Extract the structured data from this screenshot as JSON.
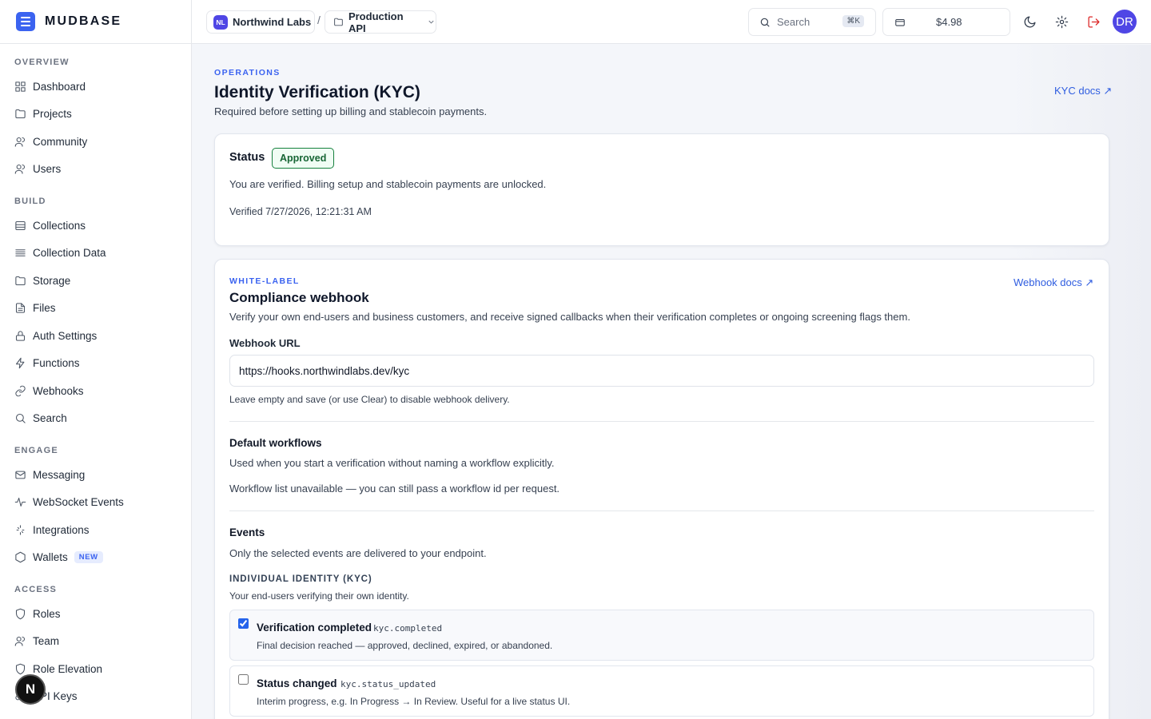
{
  "brand": {
    "name": "MUDBASE"
  },
  "sidebar": {
    "sections": [
      {
        "label": "OVERVIEW",
        "items": [
          {
            "label": "Dashboard",
            "icon": "grid-icon"
          },
          {
            "label": "Projects",
            "icon": "folder-icon"
          },
          {
            "label": "Community",
            "icon": "users-icon"
          },
          {
            "label": "Users",
            "icon": "users-icon"
          }
        ]
      },
      {
        "label": "BUILD",
        "items": [
          {
            "label": "Collections",
            "icon": "database-icon"
          },
          {
            "label": "Collection Data",
            "icon": "list-icon"
          },
          {
            "label": "Storage",
            "icon": "folder-icon"
          },
          {
            "label": "Files",
            "icon": "file-icon"
          },
          {
            "label": "Auth Settings",
            "icon": "lock-icon"
          },
          {
            "label": "Functions",
            "icon": "bolt-icon"
          },
          {
            "label": "Webhooks",
            "icon": "link-icon"
          },
          {
            "label": "Search",
            "icon": "search-icon"
          }
        ]
      },
      {
        "label": "ENGAGE",
        "items": [
          {
            "label": "Messaging",
            "icon": "mail-icon"
          },
          {
            "label": "WebSocket Events",
            "icon": "activity-icon"
          },
          {
            "label": "Integrations",
            "icon": "sparkle-icon"
          },
          {
            "label": "Wallets",
            "icon": "hexagon-icon",
            "badge": "NEW"
          }
        ]
      },
      {
        "label": "ACCESS",
        "items": [
          {
            "label": "Roles",
            "icon": "shield-icon"
          },
          {
            "label": "Team",
            "icon": "users-icon"
          },
          {
            "label": "Role Elevation",
            "icon": "shield-icon"
          },
          {
            "label": "API Keys",
            "icon": "key-icon"
          }
        ]
      }
    ],
    "floating_badge": "N"
  },
  "topbar": {
    "org_initials": "NL",
    "org_name": "Northwind Labs",
    "separator": "/",
    "project_name": "Production API",
    "search_placeholder": "Search",
    "search_shortcut": "⌘K",
    "balance": "$4.98",
    "user_initials": "DR"
  },
  "page": {
    "eyebrow": "OPERATIONS",
    "title": "Identity Verification (KYC)",
    "subtitle": "Required before setting up billing and stablecoin payments.",
    "docs_link": "KYC docs ↗"
  },
  "status_card": {
    "label": "Status",
    "badge": "Approved",
    "message": "You are verified. Billing setup and stablecoin payments are unlocked.",
    "verified_at": "Verified 7/27/2026, 12:21:31 AM",
    "badge_color": "#15803d"
  },
  "webhook_card": {
    "eyebrow": "WHITE-LABEL",
    "title": "Compliance webhook",
    "docs_link": "Webhook docs ↗",
    "description": "Verify your own end-users and business customers, and receive signed callbacks when their verification completes or ongoing screening flags them.",
    "url_label": "Webhook URL",
    "url_value": "https://hooks.northwindlabs.dev/kyc",
    "url_hint": "Leave empty and save (or use Clear) to disable webhook delivery.",
    "workflows_title": "Default workflows",
    "workflows_desc": "Used when you start a verification without naming a workflow explicitly.",
    "workflows_unavailable": "Workflow list unavailable — you can still pass a workflow id per request.",
    "events_title": "Events",
    "events_desc": "Only the selected events are delivered to your endpoint.",
    "kyc_group_label": "INDIVIDUAL IDENTITY (KYC)",
    "kyc_group_desc": "Your end-users verifying their own identity.",
    "events": [
      {
        "name": "Verification completed",
        "code": "kyc.completed",
        "desc": "Final decision reached — approved, declined, expired, or abandoned.",
        "checked": true
      },
      {
        "name": "Status changed",
        "code": "kyc.status_updated",
        "desc": "Interim progress, e.g. In Progress → In Review. Useful for a live status UI.",
        "checked": false
      }
    ]
  },
  "colors": {
    "accent": "#3b63f0",
    "link": "#2f5de0",
    "success": "#15803d",
    "danger": "#dc2626"
  }
}
